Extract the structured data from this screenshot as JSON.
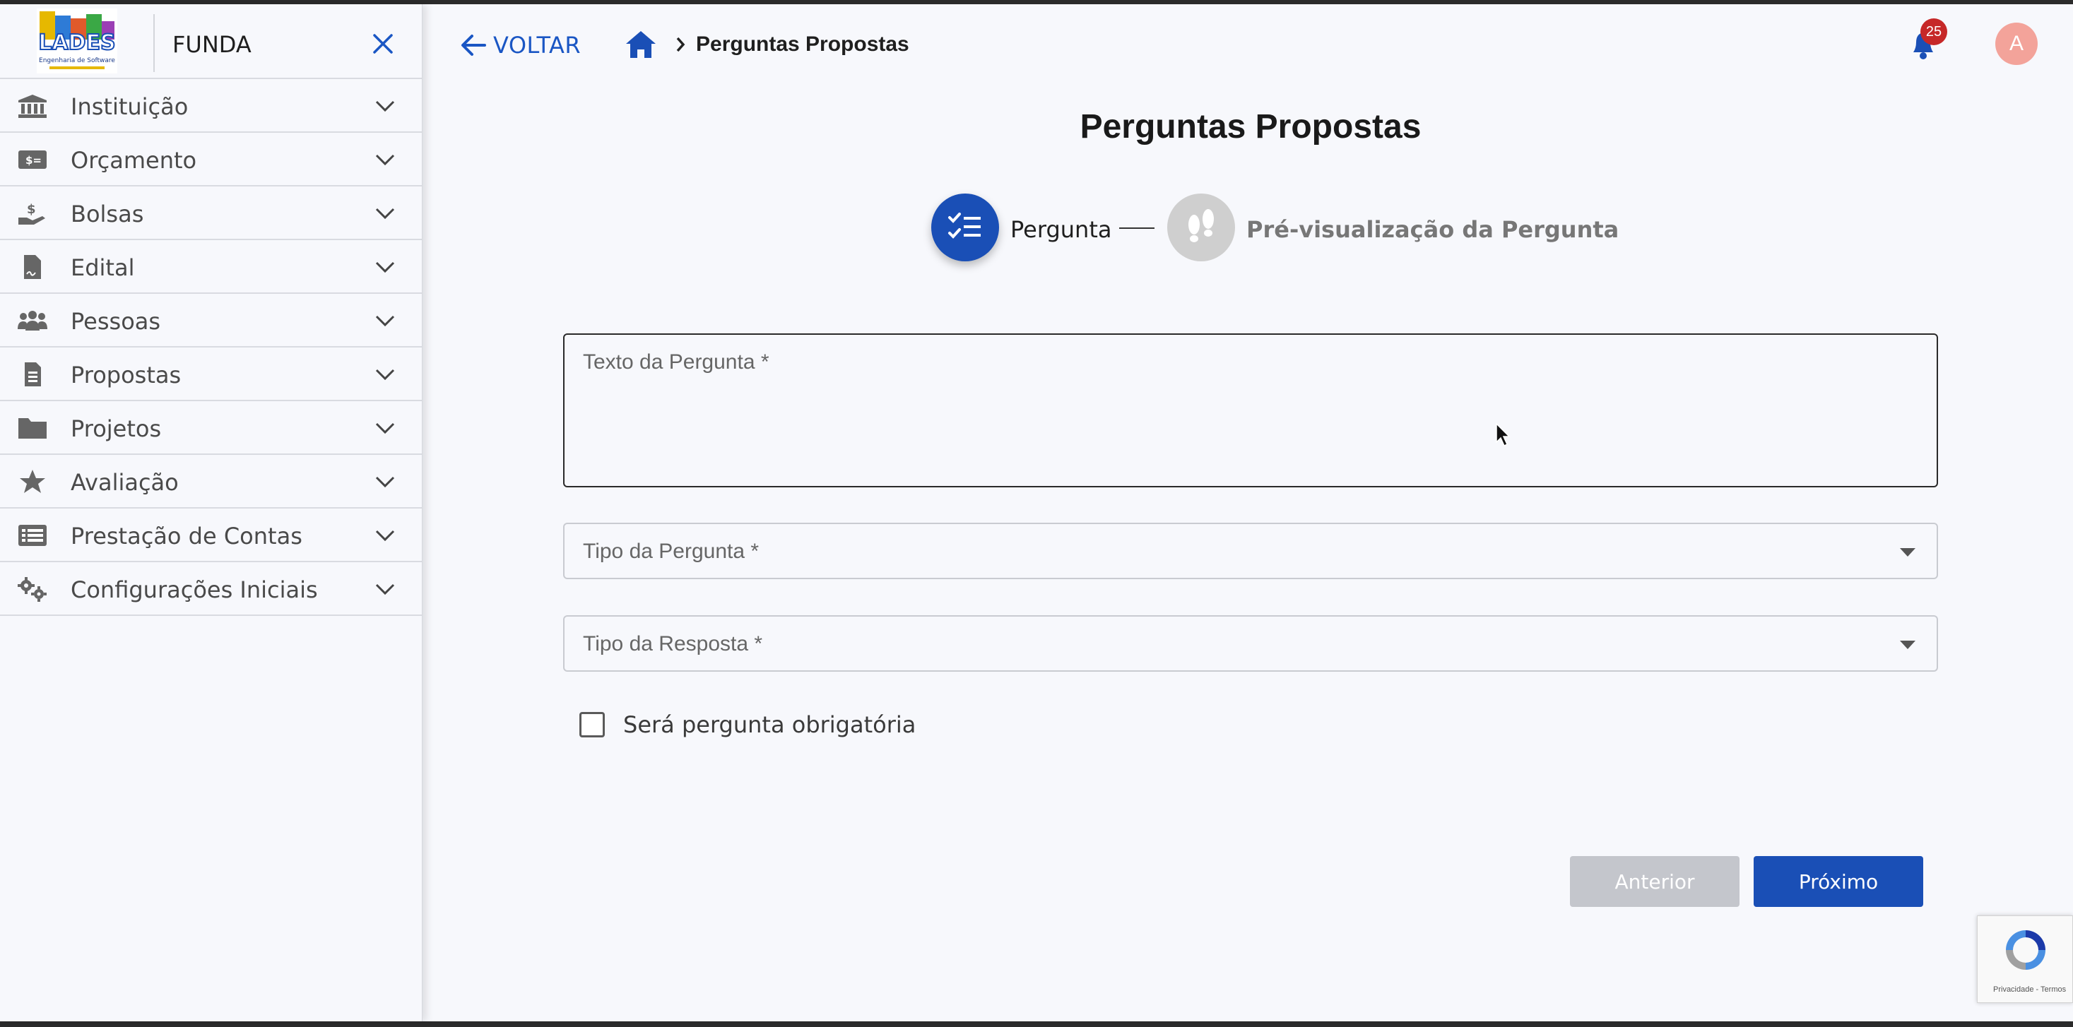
{
  "sidebar": {
    "brand": "FUNDA",
    "items": [
      {
        "label": "Instituição",
        "icon": "institution-icon"
      },
      {
        "label": "Orçamento",
        "icon": "money-bill-icon"
      },
      {
        "label": "Bolsas",
        "icon": "hand-holding-dollar-icon"
      },
      {
        "label": "Edital",
        "icon": "file-signature-icon"
      },
      {
        "label": "Pessoas",
        "icon": "users-icon"
      },
      {
        "label": "Propostas",
        "icon": "file-lines-icon"
      },
      {
        "label": "Projetos",
        "icon": "folder-icon"
      },
      {
        "label": "Avaliação",
        "icon": "star-icon"
      },
      {
        "label": "Prestação de Contas",
        "icon": "list-icon"
      },
      {
        "label": "Configurações Iniciais",
        "icon": "gears-icon"
      }
    ]
  },
  "topbar": {
    "back_label": "VOLTAR",
    "breadcrumb_current": "Perguntas Propostas",
    "notification_count": "25",
    "avatar_initial": "A"
  },
  "main": {
    "title": "Perguntas Propostas",
    "steps": [
      {
        "label": "Pergunta",
        "state": "active"
      },
      {
        "label": "Pré-visualização da Pergunta",
        "state": "inactive"
      }
    ],
    "fields": {
      "question_text_label": "Texto da Pergunta",
      "question_type_label": "Tipo da Pergunta",
      "answer_type_label": "Tipo da Resposta",
      "required_marker": " *"
    },
    "checkbox_label": "Será pergunta obrigatória",
    "checkbox_checked": false,
    "buttons": {
      "previous": "Anterior",
      "next": "Próximo"
    },
    "recaptcha_text": "Privacidade - Termos"
  },
  "colors": {
    "primary": "#1a4fb6",
    "badge": "#c62828",
    "avatar": "#f3a39a",
    "disabled_button": "#c4c6cc"
  }
}
